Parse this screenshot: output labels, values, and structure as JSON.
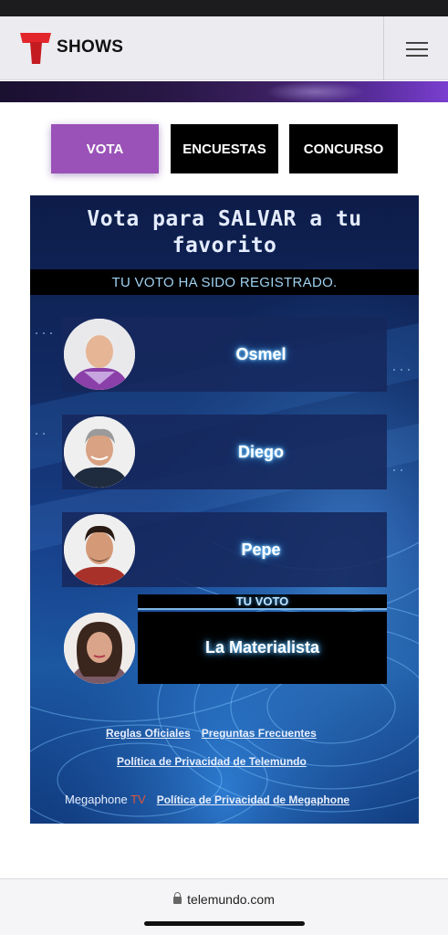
{
  "header": {
    "logo_text": "SHOWS",
    "menu_icon": "hamburger-menu-icon"
  },
  "tabs": [
    {
      "label": "VOTA",
      "active": true
    },
    {
      "label": "ENCUESTAS",
      "active": false
    },
    {
      "label": "CONCURSO",
      "active": false
    }
  ],
  "poll": {
    "title": "Vota para SALVAR a tu favorito",
    "status": "TU VOTO HA SIDO REGISTRADO.",
    "candidates": [
      {
        "name": "Osmel"
      },
      {
        "name": "Diego"
      },
      {
        "name": "Pepe"
      }
    ],
    "selected": {
      "label": "TU VOTO",
      "name": "La Materialista"
    }
  },
  "footer": {
    "links": {
      "rules": "Reglas Oficiales",
      "faq": "Preguntas Frecuentes",
      "telemundo_privacy": "Política de Privacidad de Telemundo",
      "megaphone_privacy": "Política de Privacidad de Megaphone"
    },
    "brand_text": "Megaphone",
    "brand_tv": "TV"
  },
  "browser": {
    "url": "telemundo.com"
  },
  "colors": {
    "accent_purple": "#9a52b8",
    "brand_red": "#e3262b",
    "panel_blue": "#112a62"
  }
}
